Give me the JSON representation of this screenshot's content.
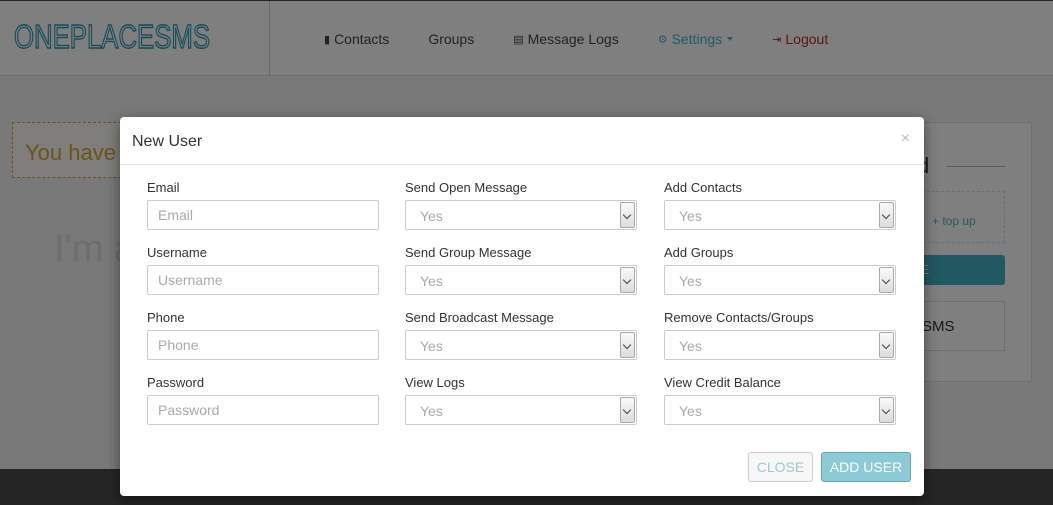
{
  "brand": {
    "name": "ONEPLACESMS"
  },
  "nav": {
    "items": [
      {
        "label": "Contacts",
        "icon": "book-icon"
      },
      {
        "label": "Groups",
        "icon": ""
      },
      {
        "label": "Message Logs",
        "icon": "document-icon"
      },
      {
        "label": "Settings",
        "icon": "gears-icon"
      },
      {
        "label": "Logout",
        "icon": "sign-out-icon"
      }
    ]
  },
  "background": {
    "alert_text": "You have",
    "hero_text": "I'm a",
    "side_panel": {
      "topup_text": "top up",
      "box_text": "ESMS"
    }
  },
  "colors": {
    "accent": "#4cb3c7",
    "logout": "#b2302b",
    "alert": "#d9a441",
    "primary_button": "#8ccad6"
  },
  "modal": {
    "title": "New User",
    "close_glyph": "×",
    "fields": {
      "email": {
        "label": "Email",
        "placeholder": "Email"
      },
      "username": {
        "label": "Username",
        "placeholder": "Username"
      },
      "phone": {
        "label": "Phone",
        "placeholder": "Phone"
      },
      "password": {
        "label": "Password",
        "placeholder": "Password"
      },
      "send_open_message": {
        "label": "Send Open Message",
        "value": "Yes"
      },
      "send_group_message": {
        "label": "Send Group Message",
        "value": "Yes"
      },
      "send_broadcast_message": {
        "label": "Send Broadcast Message",
        "value": "Yes"
      },
      "view_logs": {
        "label": "View Logs",
        "value": "Yes"
      },
      "add_contacts": {
        "label": "Add Contacts",
        "value": "Yes"
      },
      "add_groups": {
        "label": "Add Groups",
        "value": "Yes"
      },
      "remove_contacts_groups": {
        "label": "Remove Contacts/Groups",
        "value": "Yes"
      },
      "view_credit_balance": {
        "label": "View Credit Balance",
        "value": "Yes"
      }
    },
    "buttons": {
      "close": "CLOSE",
      "add_user": "ADD USER"
    }
  }
}
